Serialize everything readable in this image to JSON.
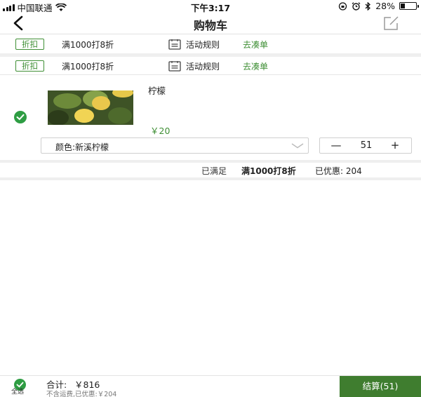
{
  "status_bar": {
    "carrier": "中国联通",
    "time": "下午3:17",
    "battery": "28%",
    "battery_level": 0.28
  },
  "nav": {
    "title": "购物车"
  },
  "promos": [
    {
      "tag": "折扣",
      "desc": "满1000打8折",
      "rule": "活动规则",
      "action": "去凑单"
    },
    {
      "tag": "折扣",
      "desc": "满1000打8折",
      "rule": "活动规则",
      "action": "去凑单"
    }
  ],
  "item": {
    "name": "柠檬",
    "price": "￥20",
    "spec": "颜色:新溪柠檬",
    "minus": "—",
    "quantity": "51",
    "plus": "+"
  },
  "summary": {
    "met": "已满足",
    "promo": "满1000打8折",
    "saved": "已优惠: 204"
  },
  "footer": {
    "select_all": "全选",
    "total_label": "合计:",
    "total_value": "￥816",
    "note": "不含运费,已优惠:￥204",
    "checkout": "结算(51)"
  },
  "colors": {
    "accent": "#3f8f35",
    "checkout_bg": "#3f7d2f",
    "check": "#2e9d43"
  },
  "icons": [
    "back-arrow-icon",
    "edit-icon",
    "rule-icon",
    "checkmark-icon",
    "chevron-down-icon",
    "wifi-icon",
    "bluetooth-icon",
    "alarm-icon",
    "lock-rotation-icon"
  ]
}
